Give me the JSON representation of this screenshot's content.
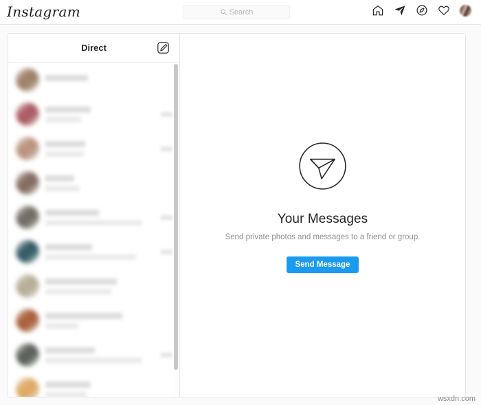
{
  "app": {
    "brand": "Instagram",
    "background_color": "#fafafa",
    "accent_color": "#1a9bf0"
  },
  "header": {
    "search": {
      "placeholder": "Search",
      "value": "",
      "icon": "search-icon"
    },
    "nav": [
      {
        "name": "home-icon",
        "label": "Home"
      },
      {
        "name": "direct-icon",
        "label": "Direct"
      },
      {
        "name": "explore-icon",
        "label": "Explore"
      },
      {
        "name": "activity-heart-icon",
        "label": "Activity"
      },
      {
        "name": "profile-avatar",
        "label": "Profile"
      }
    ]
  },
  "sidebar": {
    "title": "Direct",
    "compose_icon": "new-message-icon",
    "threads": [
      {
        "avatar_color": "#9c7b63",
        "name_width": 62,
        "preview_width": 0,
        "has_timestamp": false
      },
      {
        "avatar_color": "#a8545e",
        "name_width": 66,
        "preview_width": 52,
        "has_timestamp": true
      },
      {
        "avatar_color": "#b98f7a",
        "name_width": 58,
        "preview_width": 56,
        "has_timestamp": true
      },
      {
        "avatar_color": "#7e675c",
        "name_width": 42,
        "preview_width": 50,
        "has_timestamp": false
      },
      {
        "avatar_color": "#6d665f",
        "name_width": 78,
        "preview_width": 140,
        "has_timestamp": true
      },
      {
        "avatar_color": "#2d5560",
        "name_width": 68,
        "preview_width": 132,
        "has_timestamp": true
      },
      {
        "avatar_color": "#b3ab94",
        "name_width": 104,
        "preview_width": 96,
        "has_timestamp": false
      },
      {
        "avatar_color": "#a55a33",
        "name_width": 112,
        "preview_width": 48,
        "has_timestamp": false
      },
      {
        "avatar_color": "#555a55",
        "name_width": 72,
        "preview_width": 140,
        "has_timestamp": true
      },
      {
        "avatar_color": "#e0a661",
        "name_width": 66,
        "preview_width": 60,
        "has_timestamp": false
      }
    ]
  },
  "empty_state": {
    "icon": "paper-plane-circle-icon",
    "title": "Your Messages",
    "subtitle": "Send private photos and messages to a friend or group.",
    "button_label": "Send Message"
  },
  "watermark": {
    "text": "wsxdn.com"
  }
}
